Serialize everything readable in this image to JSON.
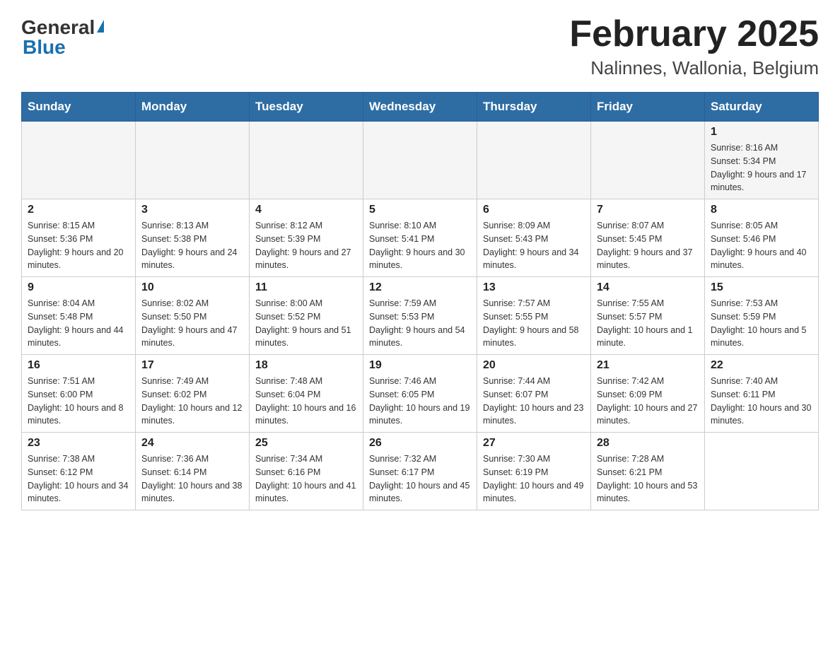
{
  "header": {
    "logo_general": "General",
    "logo_blue": "Blue",
    "title": "February 2025",
    "subtitle": "Nalinnes, Wallonia, Belgium"
  },
  "weekdays": [
    "Sunday",
    "Monday",
    "Tuesday",
    "Wednesday",
    "Thursday",
    "Friday",
    "Saturday"
  ],
  "weeks": [
    [
      {
        "day": "",
        "info": ""
      },
      {
        "day": "",
        "info": ""
      },
      {
        "day": "",
        "info": ""
      },
      {
        "day": "",
        "info": ""
      },
      {
        "day": "",
        "info": ""
      },
      {
        "day": "",
        "info": ""
      },
      {
        "day": "1",
        "info": "Sunrise: 8:16 AM\nSunset: 5:34 PM\nDaylight: 9 hours and 17 minutes."
      }
    ],
    [
      {
        "day": "2",
        "info": "Sunrise: 8:15 AM\nSunset: 5:36 PM\nDaylight: 9 hours and 20 minutes."
      },
      {
        "day": "3",
        "info": "Sunrise: 8:13 AM\nSunset: 5:38 PM\nDaylight: 9 hours and 24 minutes."
      },
      {
        "day": "4",
        "info": "Sunrise: 8:12 AM\nSunset: 5:39 PM\nDaylight: 9 hours and 27 minutes."
      },
      {
        "day": "5",
        "info": "Sunrise: 8:10 AM\nSunset: 5:41 PM\nDaylight: 9 hours and 30 minutes."
      },
      {
        "day": "6",
        "info": "Sunrise: 8:09 AM\nSunset: 5:43 PM\nDaylight: 9 hours and 34 minutes."
      },
      {
        "day": "7",
        "info": "Sunrise: 8:07 AM\nSunset: 5:45 PM\nDaylight: 9 hours and 37 minutes."
      },
      {
        "day": "8",
        "info": "Sunrise: 8:05 AM\nSunset: 5:46 PM\nDaylight: 9 hours and 40 minutes."
      }
    ],
    [
      {
        "day": "9",
        "info": "Sunrise: 8:04 AM\nSunset: 5:48 PM\nDaylight: 9 hours and 44 minutes."
      },
      {
        "day": "10",
        "info": "Sunrise: 8:02 AM\nSunset: 5:50 PM\nDaylight: 9 hours and 47 minutes."
      },
      {
        "day": "11",
        "info": "Sunrise: 8:00 AM\nSunset: 5:52 PM\nDaylight: 9 hours and 51 minutes."
      },
      {
        "day": "12",
        "info": "Sunrise: 7:59 AM\nSunset: 5:53 PM\nDaylight: 9 hours and 54 minutes."
      },
      {
        "day": "13",
        "info": "Sunrise: 7:57 AM\nSunset: 5:55 PM\nDaylight: 9 hours and 58 minutes."
      },
      {
        "day": "14",
        "info": "Sunrise: 7:55 AM\nSunset: 5:57 PM\nDaylight: 10 hours and 1 minute."
      },
      {
        "day": "15",
        "info": "Sunrise: 7:53 AM\nSunset: 5:59 PM\nDaylight: 10 hours and 5 minutes."
      }
    ],
    [
      {
        "day": "16",
        "info": "Sunrise: 7:51 AM\nSunset: 6:00 PM\nDaylight: 10 hours and 8 minutes."
      },
      {
        "day": "17",
        "info": "Sunrise: 7:49 AM\nSunset: 6:02 PM\nDaylight: 10 hours and 12 minutes."
      },
      {
        "day": "18",
        "info": "Sunrise: 7:48 AM\nSunset: 6:04 PM\nDaylight: 10 hours and 16 minutes."
      },
      {
        "day": "19",
        "info": "Sunrise: 7:46 AM\nSunset: 6:05 PM\nDaylight: 10 hours and 19 minutes."
      },
      {
        "day": "20",
        "info": "Sunrise: 7:44 AM\nSunset: 6:07 PM\nDaylight: 10 hours and 23 minutes."
      },
      {
        "day": "21",
        "info": "Sunrise: 7:42 AM\nSunset: 6:09 PM\nDaylight: 10 hours and 27 minutes."
      },
      {
        "day": "22",
        "info": "Sunrise: 7:40 AM\nSunset: 6:11 PM\nDaylight: 10 hours and 30 minutes."
      }
    ],
    [
      {
        "day": "23",
        "info": "Sunrise: 7:38 AM\nSunset: 6:12 PM\nDaylight: 10 hours and 34 minutes."
      },
      {
        "day": "24",
        "info": "Sunrise: 7:36 AM\nSunset: 6:14 PM\nDaylight: 10 hours and 38 minutes."
      },
      {
        "day": "25",
        "info": "Sunrise: 7:34 AM\nSunset: 6:16 PM\nDaylight: 10 hours and 41 minutes."
      },
      {
        "day": "26",
        "info": "Sunrise: 7:32 AM\nSunset: 6:17 PM\nDaylight: 10 hours and 45 minutes."
      },
      {
        "day": "27",
        "info": "Sunrise: 7:30 AM\nSunset: 6:19 PM\nDaylight: 10 hours and 49 minutes."
      },
      {
        "day": "28",
        "info": "Sunrise: 7:28 AM\nSunset: 6:21 PM\nDaylight: 10 hours and 53 minutes."
      },
      {
        "day": "",
        "info": ""
      }
    ]
  ]
}
